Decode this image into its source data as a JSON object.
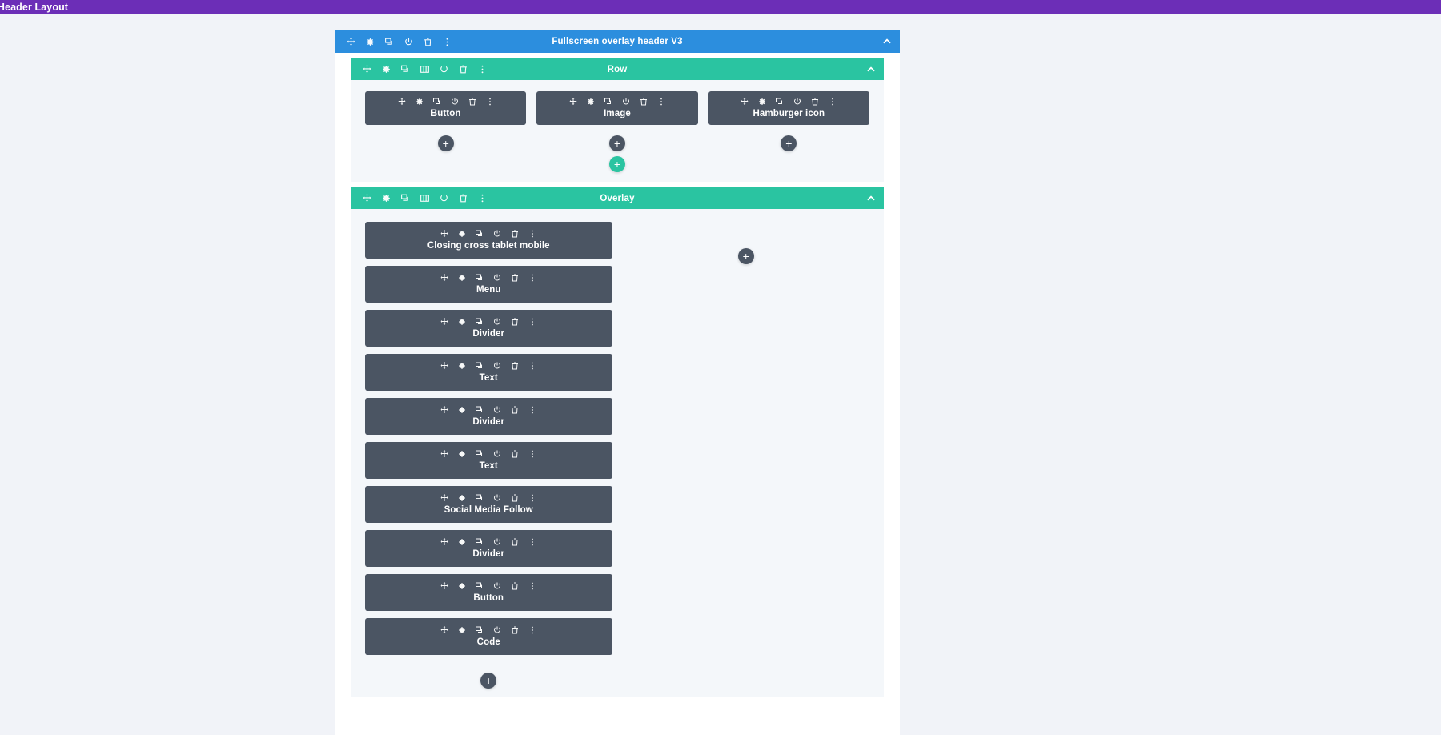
{
  "topbar": {
    "title": "bal Header Layout",
    "color": "#6c2eb7"
  },
  "colors": {
    "section": "#2c8ede",
    "row": "#2ac4a1",
    "module": "#4b5563",
    "canvas": "#f1f3f8",
    "row_body": "#f4f7fa"
  },
  "section": {
    "title": "Fullscreen overlay header V3",
    "icons": [
      "move-icon",
      "gear-icon",
      "duplicate-icon",
      "power-icon",
      "trash-icon",
      "dots-menu-icon"
    ],
    "collapse_icon": "chevron-up-icon"
  },
  "rows": [
    {
      "title": "Row",
      "icons": [
        "move-icon",
        "gear-icon",
        "duplicate-icon",
        "columns-icon",
        "power-icon",
        "trash-icon",
        "dots-menu-icon"
      ],
      "collapse_icon": "chevron-up-icon",
      "columns": [
        {
          "modules": [
            {
              "label": "Button"
            }
          ],
          "add_label": "+"
        },
        {
          "modules": [
            {
              "label": "Image"
            }
          ],
          "add_label": "+"
        },
        {
          "modules": [
            {
              "label": "Hamburger icon"
            }
          ],
          "add_label": "+"
        }
      ],
      "add_row_label": "+"
    },
    {
      "title": "Overlay",
      "icons": [
        "move-icon",
        "gear-icon",
        "duplicate-icon",
        "columns-icon",
        "power-icon",
        "trash-icon",
        "dots-menu-icon"
      ],
      "collapse_icon": "chevron-up-icon",
      "columns": [
        {
          "modules": [
            {
              "label": "Closing cross tablet mobile"
            },
            {
              "label": "Menu"
            },
            {
              "label": "Divider"
            },
            {
              "label": "Text"
            },
            {
              "label": "Divider"
            },
            {
              "label": "Text"
            },
            {
              "label": "Social Media Follow"
            },
            {
              "label": "Divider"
            },
            {
              "label": "Button"
            },
            {
              "label": "Code"
            }
          ],
          "add_label": "+"
        },
        {
          "modules": [],
          "add_label": "+"
        }
      ]
    }
  ],
  "module_icons": [
    "move-icon",
    "gear-icon",
    "duplicate-icon",
    "power-icon",
    "trash-icon",
    "dots-menu-icon"
  ]
}
